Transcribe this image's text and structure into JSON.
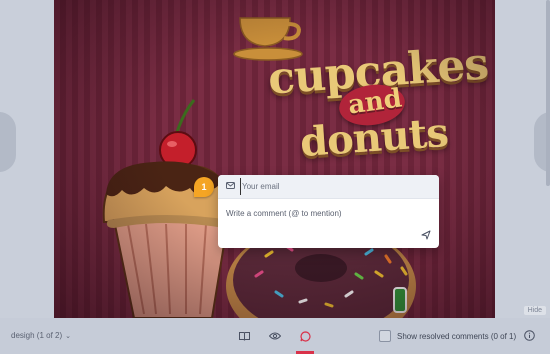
{
  "artboard": {
    "title_line1": "cupcakes",
    "title_line2": "and",
    "title_line3": "donuts"
  },
  "comment": {
    "pin_number": "1",
    "email_placeholder": "Your email",
    "comment_placeholder": "Write a comment (@ to mention)",
    "icons": {
      "email": "mail-icon",
      "send": "send-icon"
    }
  },
  "viewer": {
    "hide_label": "Hide"
  },
  "footer": {
    "page_select": "desigh (1 of 2)",
    "resolved_label": "Show resolved comments (0 of 1)",
    "resolved_checked": false,
    "active_tool": "comment",
    "icons": [
      "book-icon",
      "eye-icon",
      "comment-icon",
      "info-icon",
      "chevron-down-icon"
    ],
    "accent_color": "#d9324a"
  }
}
